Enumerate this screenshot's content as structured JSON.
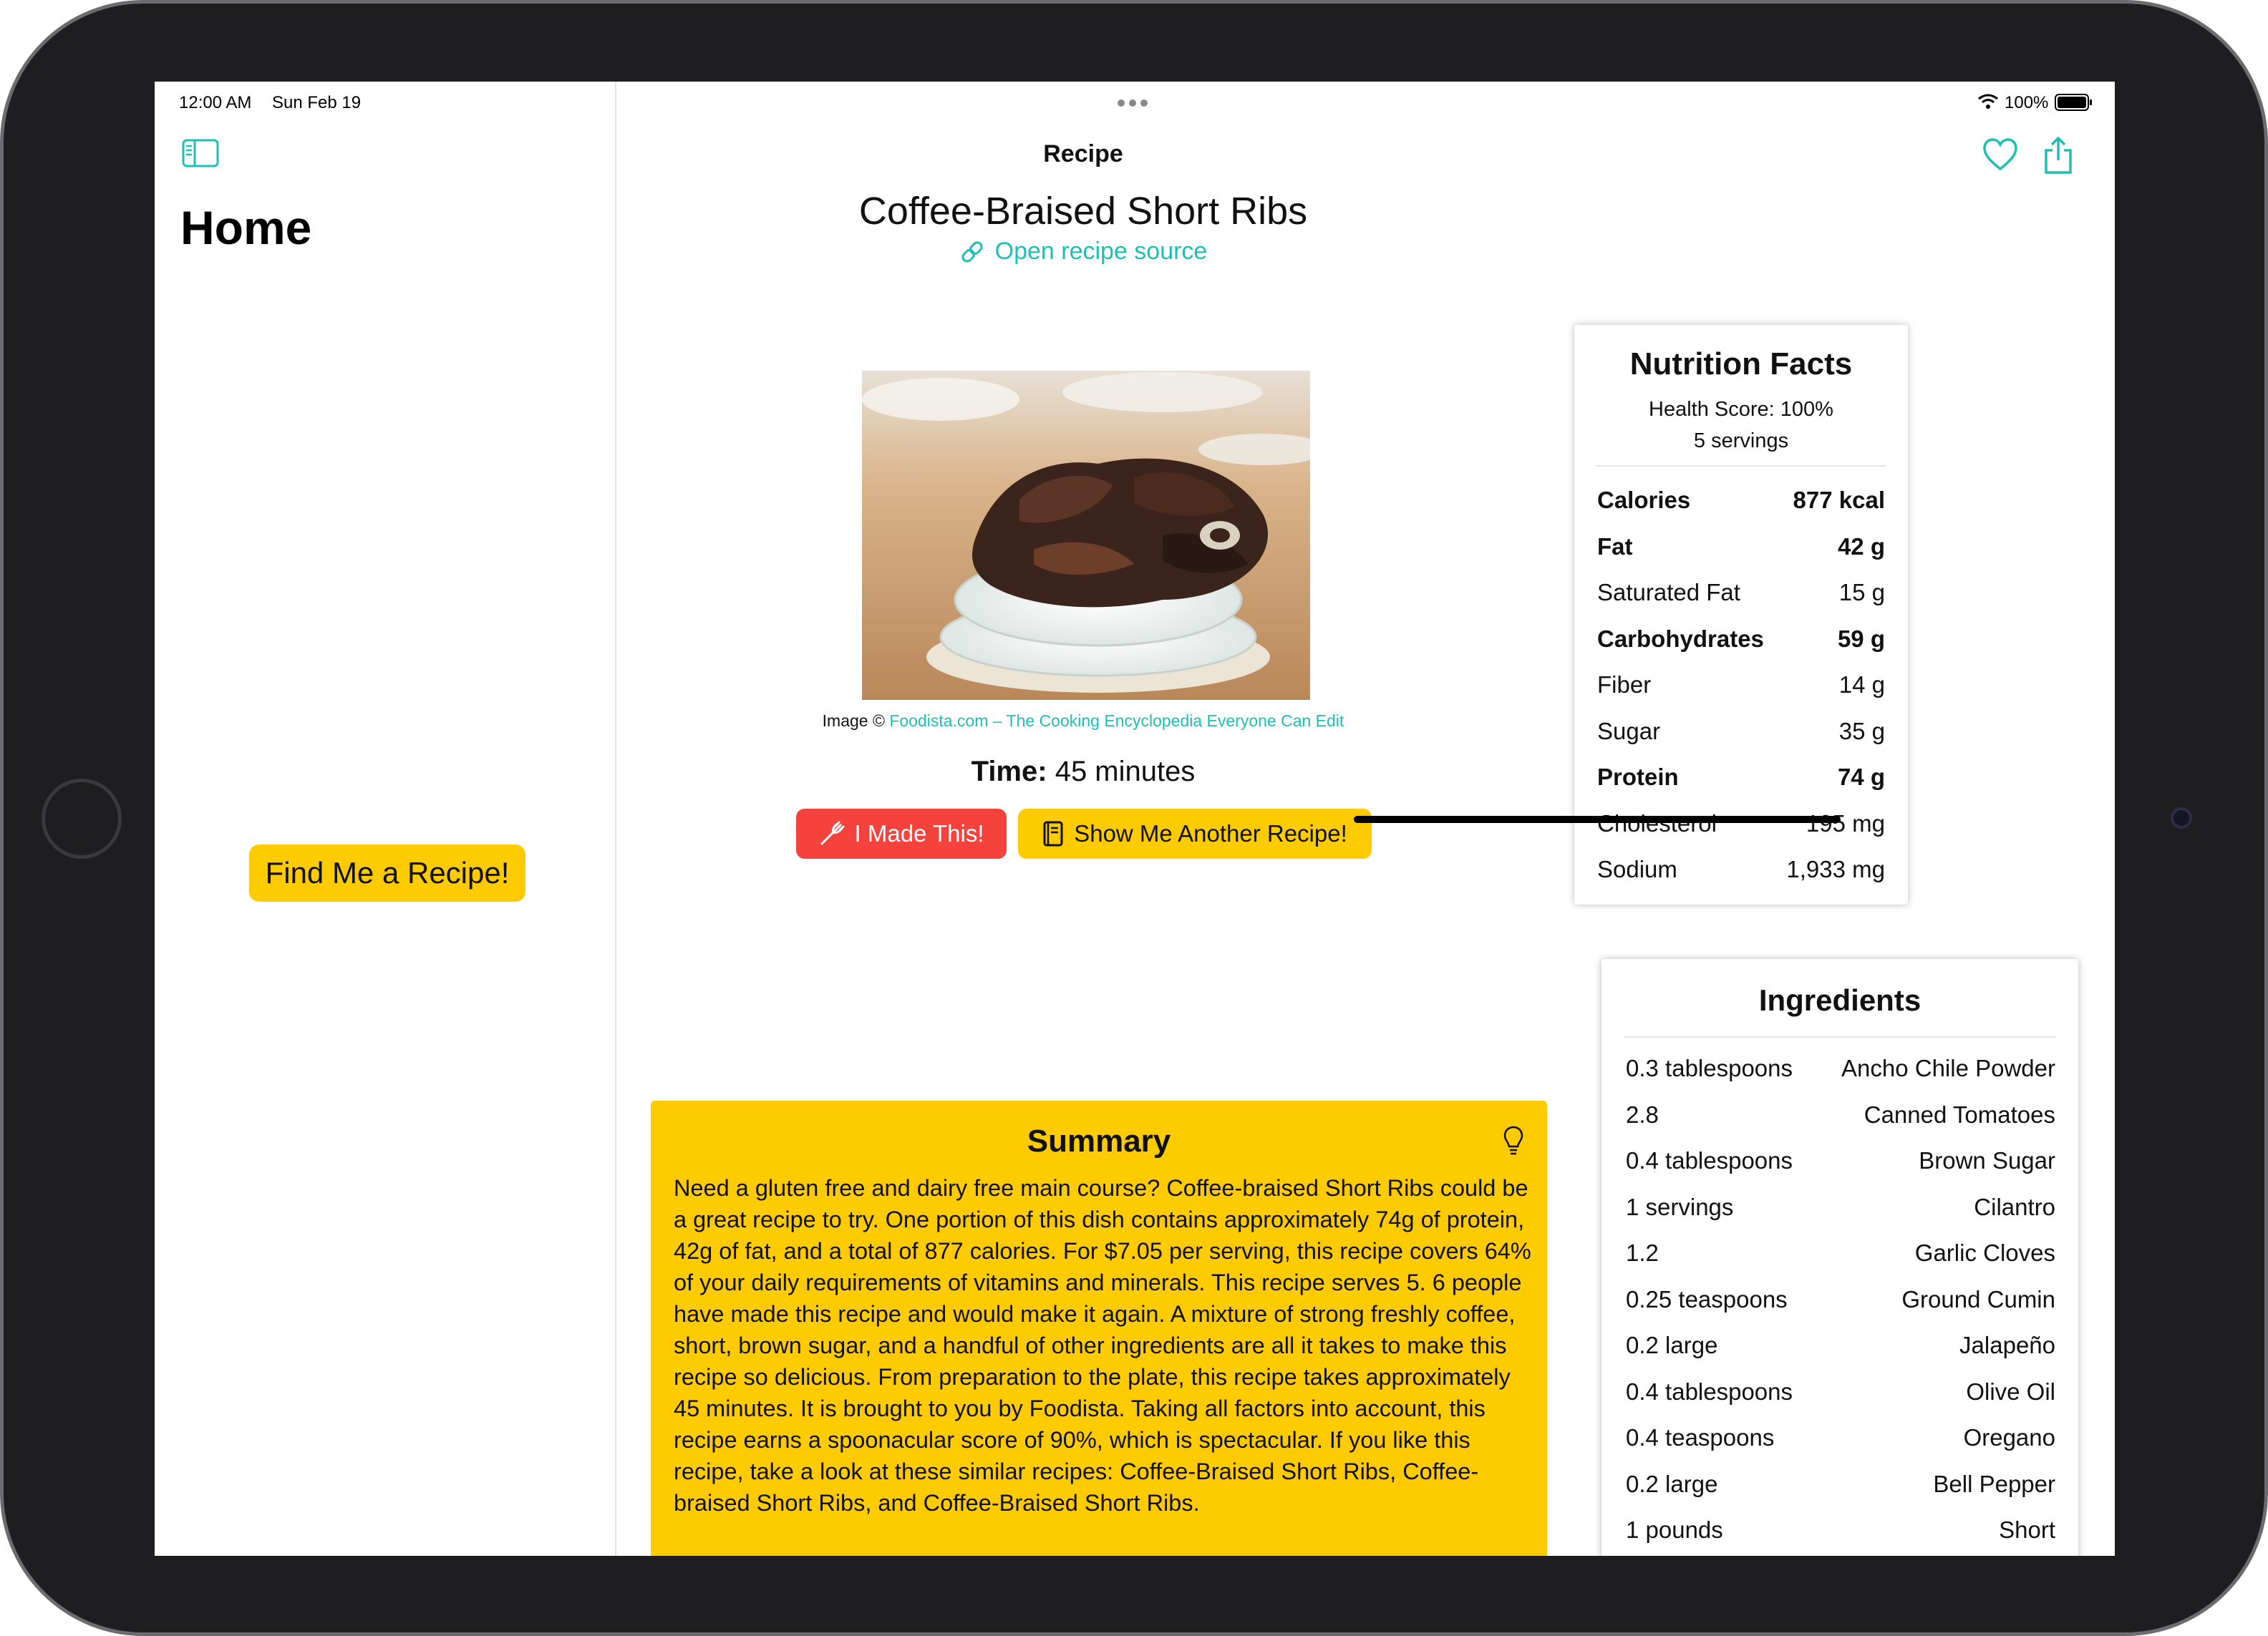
{
  "status": {
    "time": "12:00 AM",
    "date": "Sun Feb 19",
    "battery": "100%"
  },
  "sidebar": {
    "title": "Home",
    "find_button": "Find Me a Recipe!"
  },
  "nav": {
    "title": "Recipe"
  },
  "recipe": {
    "title": "Coffee-Braised Short Ribs",
    "source_link": "Open recipe source",
    "image_credit_prefix": "Image ©",
    "image_credit_link": "Foodista.com – The Cooking Encyclopedia Everyone Can Edit",
    "time_label": "Time:",
    "time_value": "45 minutes",
    "made_button": "I Made This!",
    "another_button": "Show Me Another Recipe!"
  },
  "nutrition": {
    "title": "Nutrition Facts",
    "health_score": "Health Score: 100%",
    "servings": "5 servings",
    "rows": [
      {
        "label": "Calories",
        "value": "877 kcal",
        "bold": true
      },
      {
        "label": "Fat",
        "value": "42 g",
        "bold": true
      },
      {
        "label": "Saturated Fat",
        "value": "15 g",
        "bold": false
      },
      {
        "label": "Carbohydrates",
        "value": "59 g",
        "bold": true
      },
      {
        "label": "Fiber",
        "value": "14 g",
        "bold": false
      },
      {
        "label": "Sugar",
        "value": "35 g",
        "bold": false
      },
      {
        "label": "Protein",
        "value": "74 g",
        "bold": true
      },
      {
        "label": "Cholesterol",
        "value": "195 mg",
        "bold": false
      },
      {
        "label": "Sodium",
        "value": "1,933 mg",
        "bold": false
      }
    ]
  },
  "ingredients": {
    "title": "Ingredients",
    "rows": [
      {
        "amount": "0.3 tablespoons",
        "name": "Ancho Chile Powder"
      },
      {
        "amount": "2.8",
        "name": "Canned Tomatoes"
      },
      {
        "amount": "0.4 tablespoons",
        "name": "Brown Sugar"
      },
      {
        "amount": "1 servings",
        "name": "Cilantro"
      },
      {
        "amount": "1.2",
        "name": "Garlic Cloves"
      },
      {
        "amount": "0.25 teaspoons",
        "name": "Ground Cumin"
      },
      {
        "amount": "0.2 large",
        "name": "Jalapeño"
      },
      {
        "amount": "0.4 tablespoons",
        "name": "Olive Oil"
      },
      {
        "amount": "0.4 teaspoons",
        "name": "Oregano"
      },
      {
        "amount": "0.2 large",
        "name": "Bell Pepper"
      },
      {
        "amount": "1 pounds",
        "name": "Short"
      }
    ]
  },
  "summary": {
    "title": "Summary",
    "text": "Need a gluten free and dairy free main course? Coffee-braised Short Ribs could be a great recipe to try. One portion of this dish contains approximately 74g of protein, 42g of fat, and a total of 877 calories. For $7.05 per serving, this recipe covers 64% of your daily requirements of vitamins and minerals. This recipe serves 5. 6 people have made this recipe and would make it again. A mixture of strong freshly coffee, short, brown sugar, and a handful of other ingredients are all it takes to make this recipe so delicious. From preparation to the plate, this recipe takes approximately 45 minutes. It is brought to you by Foodista. Taking all factors into account, this recipe earns a spoonacular score of 90%, which is spectacular. If you like this recipe, take a look at these similar recipes: Coffee-Braised Short Ribs, Coffee-braised Short Ribs, and Coffee-Braised Short Ribs."
  },
  "icons": {
    "sidebar_toggle": "sidebar-icon",
    "favorite": "heart-icon",
    "share": "share-icon",
    "link": "link-icon",
    "made": "fork-icon",
    "another": "book-icon",
    "summary": "lightbulb-icon"
  },
  "colors": {
    "accent": "#1fbfb1",
    "yellow": "#fecb00",
    "red": "#f6423c"
  }
}
